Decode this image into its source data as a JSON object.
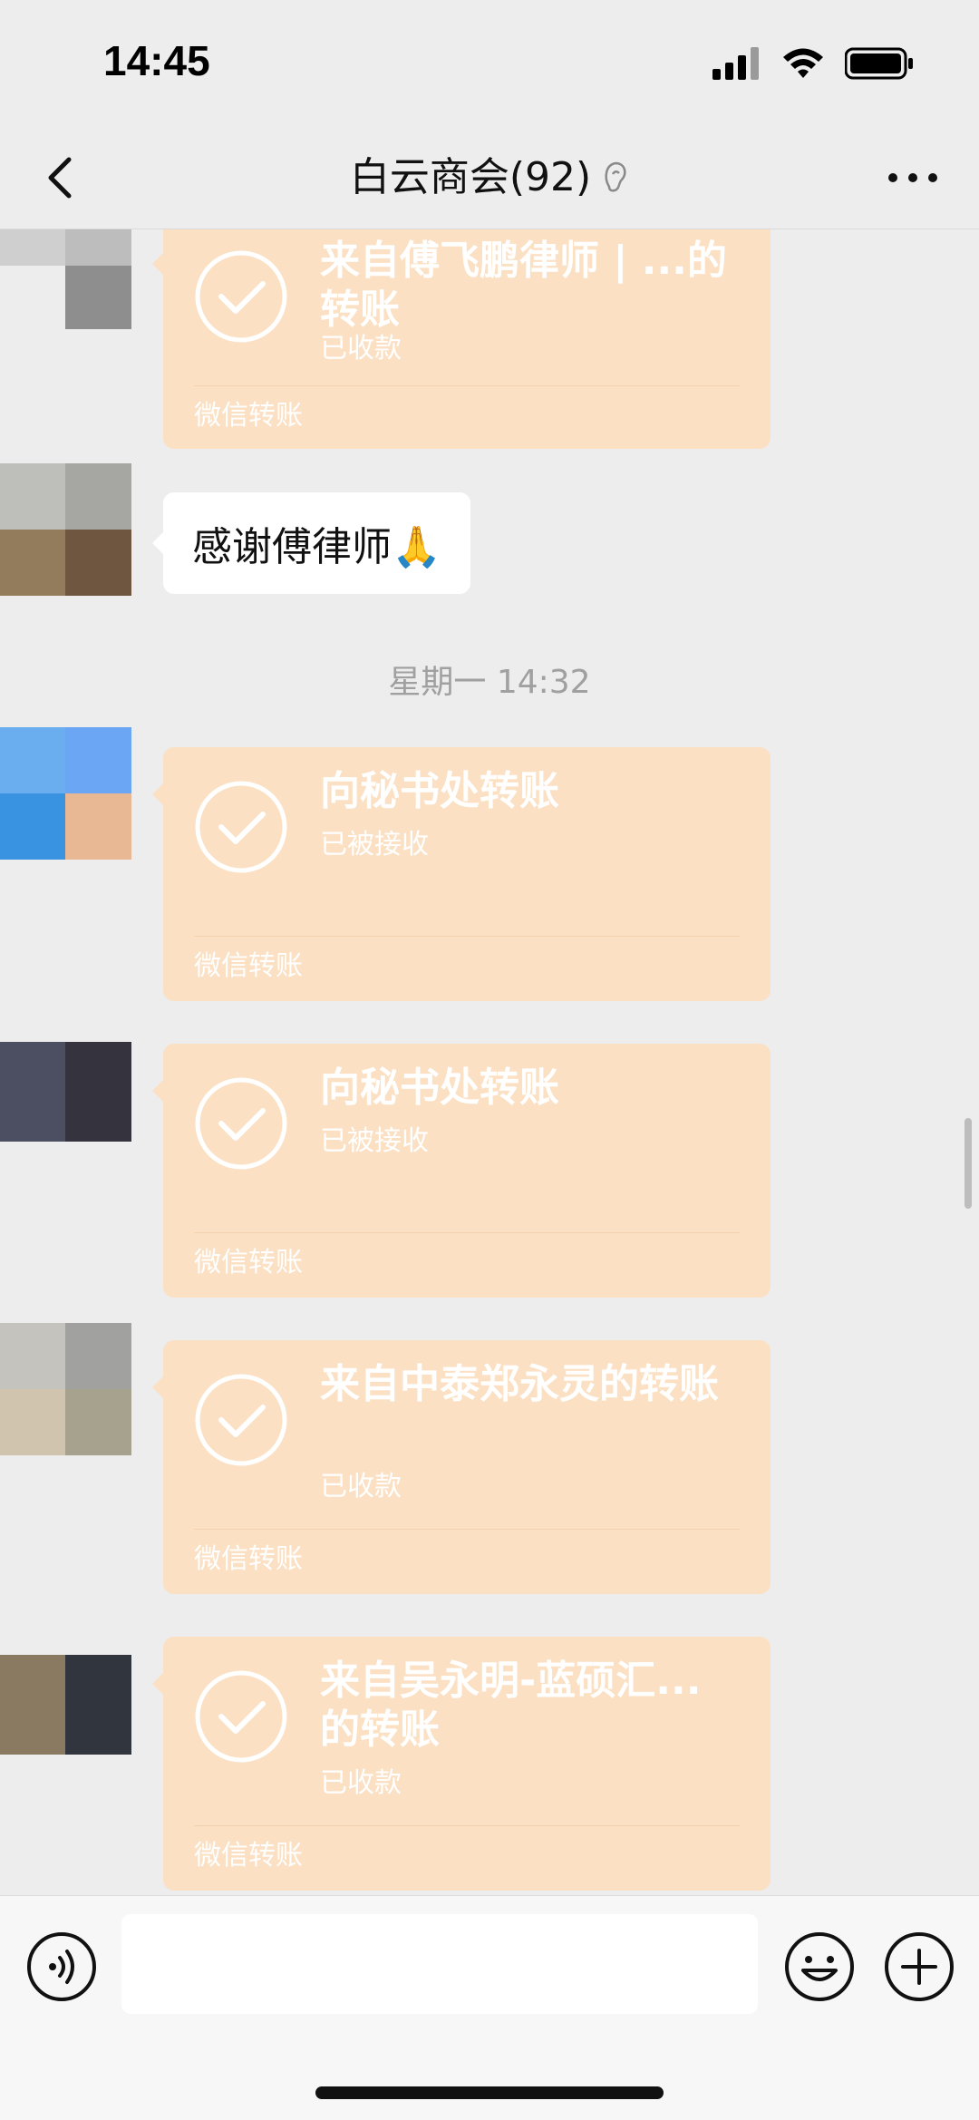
{
  "status_bar": {
    "time": "14:45"
  },
  "header": {
    "title": "白云商会(92)"
  },
  "messages": {
    "transfer_1": {
      "title": "来自傅飞鹏律师 | ...的转账",
      "status": "已收款",
      "footer": "微信转账"
    },
    "text_1": {
      "text": "感谢傅律师🙏"
    },
    "timestamp_1": {
      "text": "星期一 14:32"
    },
    "transfer_2": {
      "title": "向秘书处转账",
      "status": "已被接收",
      "footer": "微信转账"
    },
    "transfer_3": {
      "title": "向秘书处转账",
      "status": "已被接收",
      "footer": "微信转账"
    },
    "transfer_4": {
      "title": "来自中泰郑永灵的转账",
      "status": "已收款",
      "footer": "微信转账"
    },
    "transfer_5": {
      "title": "来自吴永明-蓝硕汇...的转账",
      "status": "已收款",
      "footer": "微信转账"
    }
  },
  "colors": {
    "transfer_card": "#FBE0C3",
    "background": "#EDEDED",
    "bubble": "#FFFFFF"
  },
  "icons": [
    "back-icon",
    "mute-icon",
    "more-icon",
    "check-icon",
    "voice-icon",
    "emoji-icon",
    "plus-icon"
  ]
}
